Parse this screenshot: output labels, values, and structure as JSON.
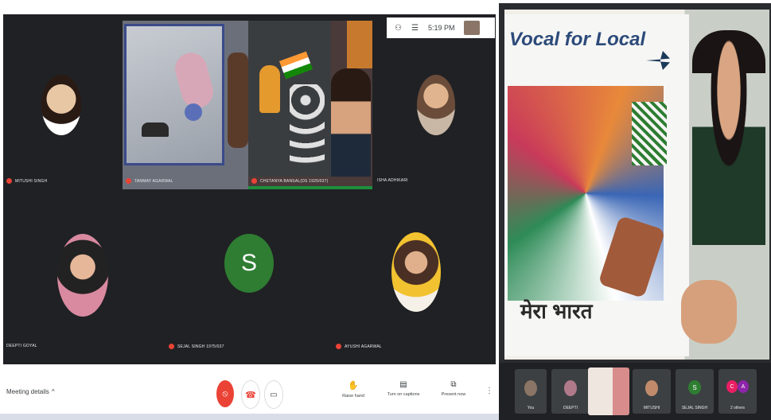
{
  "top_bar": {
    "time": "5:19 PM"
  },
  "participants": {
    "mitushi": "MITUSHI SINGH",
    "tanmay": "TANMAY AGARWAL",
    "chetanya": "CHETANYA BANSAL(DS 1925/037)",
    "isha": "ISHA ADHIKARI",
    "deepti": "DEEPTI GOYAL",
    "sejal": "SEJAL SINGH 1975/037",
    "ayushi": "AYUSHI AGARWAL",
    "sejal_initial": "S"
  },
  "presentation": {
    "line1": "Vocal for Local",
    "line2": "मेरा भारत"
  },
  "bottom": {
    "meeting_details": "Meeting details",
    "raise_hand": "Raise hand",
    "captions": "Turn on captions",
    "present": "Present now"
  },
  "filmstrip": [
    {
      "label": "You"
    },
    {
      "label": "DEEPTI"
    },
    {
      "label": ""
    },
    {
      "label": "MITUSHI"
    },
    {
      "label": "SEJAL SINGH",
      "initial": "S"
    },
    {
      "label": "2 others",
      "initials": [
        "C",
        "A"
      ]
    }
  ],
  "colors": {
    "dark": "#202124",
    "mic_red": "#ea4335",
    "avatar_green": "#2e7d32",
    "hangup": "#ea4335"
  }
}
